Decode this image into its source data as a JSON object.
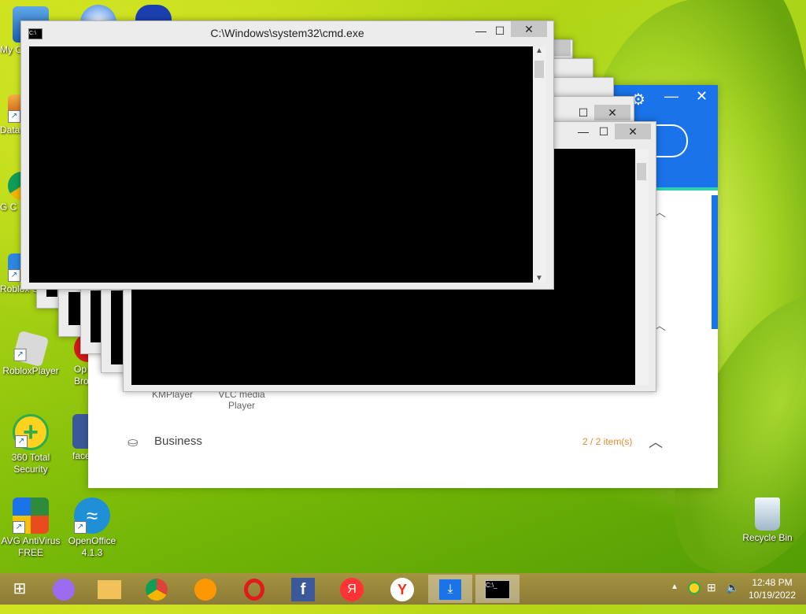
{
  "desktop": {
    "icons": [
      {
        "label": "My C",
        "icon": "computer-icon"
      },
      {
        "label": "Data",
        "icon": "data-icon"
      },
      {
        "label": "G C",
        "icon": "chrome-icon"
      },
      {
        "label": "Roblox St",
        "icon": "roblox-studio-icon"
      },
      {
        "label": "RobloxPlayer",
        "icon": "roblox-player-icon"
      },
      {
        "label": "Op Bro",
        "icon": "opera-icon"
      },
      {
        "label": "360 Total Security",
        "icon": "shield-plus-icon"
      },
      {
        "label": "face",
        "icon": "facebook-icon"
      },
      {
        "label": "AVG AntiVirus FREE",
        "icon": "avg-icon"
      },
      {
        "label": "OpenOffice 4.1.3",
        "icon": "openoffice-icon"
      },
      {
        "label": "Recycle Bin",
        "icon": "recycle-bin-icon"
      }
    ]
  },
  "cmd_window": {
    "title": "C:\\Windows\\system32\\cmd.exe",
    "minimize": "—",
    "maximize": "☐",
    "close": "✕"
  },
  "app_window": {
    "items_visible": [
      "KMPlayer",
      "VLC media Player"
    ],
    "section_label": "Business",
    "section_count": "2 / 2 item(s)",
    "accent": "#1a73e8",
    "count_color": "#e38b2c"
  },
  "taskbar": {
    "apps": [
      "start-icon",
      "assistant-icon",
      "file-explorer-icon",
      "chrome-icon",
      "browser-icon",
      "opera-icon",
      "facebook-icon",
      "yandex-icon",
      "yandex-browser-icon",
      "downloader-icon",
      "cmd-icon"
    ],
    "time": "12:48 PM",
    "date": "10/19/2022"
  }
}
